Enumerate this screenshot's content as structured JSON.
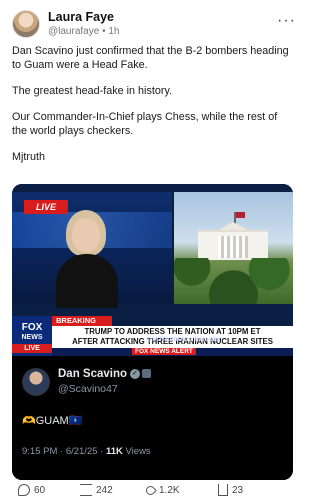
{
  "post": {
    "author": "Laura Faye",
    "handle": "@laurafaye",
    "dot": "•",
    "time": "1h",
    "more_label": "···",
    "paragraphs": [
      "Dan Scavino just confirmed that the B-2 bombers heading to Guam were a Head Fake.",
      "The greatest head-fake in history.",
      "Our Commander-In-Chief plays Chess, while the rest of the world plays checkers.",
      "Mjtruth"
    ]
  },
  "video": {
    "live_badge": "LIVE",
    "network_line1": "FOX",
    "network_line2": "NEWS",
    "network_live": "LIVE",
    "breaking": "BREAKING NEWS",
    "headline_line1": "TRUMP TO ADDRESS THE NATION AT 10PM ET",
    "headline_line2": "AFTER ATTACKING THREE IRANIAN NUCLEAR SITES",
    "alert": "FOX NEWS ALERT",
    "watermark": "@MJTruthUltra Reloads"
  },
  "embedded_tweet": {
    "name": "Dan Scavino",
    "handle": "@Scavino47",
    "text": "🫶GUAM🇬🇺",
    "time": "9:15 PM · 6/21/25 ·",
    "views_count": "11K",
    "views_label": "Views"
  },
  "actions": {
    "replies": "60",
    "reposts": "242",
    "likes": "1.2K",
    "shares": "23"
  },
  "icons": [
    "globe-icon",
    "more-icon",
    "verified-icon",
    "reply-icon",
    "repost-icon",
    "like-icon",
    "share-icon"
  ]
}
